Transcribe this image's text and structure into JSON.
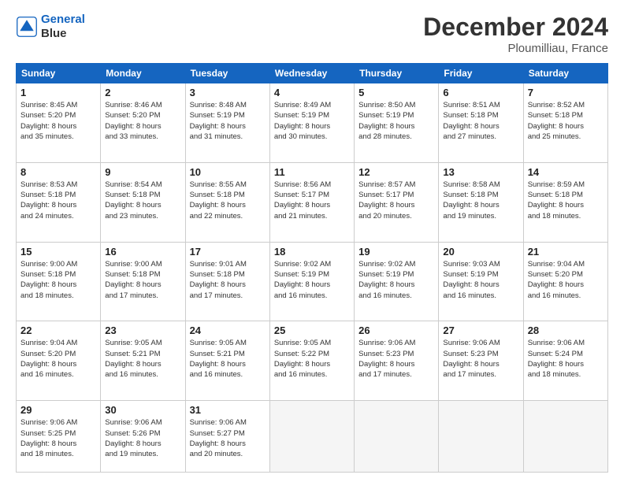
{
  "header": {
    "logo_line1": "General",
    "logo_line2": "Blue",
    "month": "December 2024",
    "location": "Ploumilliau, France"
  },
  "weekdays": [
    "Sunday",
    "Monday",
    "Tuesday",
    "Wednesday",
    "Thursday",
    "Friday",
    "Saturday"
  ],
  "weeks": [
    [
      {
        "day": "1",
        "info": "Sunrise: 8:45 AM\nSunset: 5:20 PM\nDaylight: 8 hours\nand 35 minutes."
      },
      {
        "day": "2",
        "info": "Sunrise: 8:46 AM\nSunset: 5:20 PM\nDaylight: 8 hours\nand 33 minutes."
      },
      {
        "day": "3",
        "info": "Sunrise: 8:48 AM\nSunset: 5:19 PM\nDaylight: 8 hours\nand 31 minutes."
      },
      {
        "day": "4",
        "info": "Sunrise: 8:49 AM\nSunset: 5:19 PM\nDaylight: 8 hours\nand 30 minutes."
      },
      {
        "day": "5",
        "info": "Sunrise: 8:50 AM\nSunset: 5:19 PM\nDaylight: 8 hours\nand 28 minutes."
      },
      {
        "day": "6",
        "info": "Sunrise: 8:51 AM\nSunset: 5:18 PM\nDaylight: 8 hours\nand 27 minutes."
      },
      {
        "day": "7",
        "info": "Sunrise: 8:52 AM\nSunset: 5:18 PM\nDaylight: 8 hours\nand 25 minutes."
      }
    ],
    [
      {
        "day": "8",
        "info": "Sunrise: 8:53 AM\nSunset: 5:18 PM\nDaylight: 8 hours\nand 24 minutes."
      },
      {
        "day": "9",
        "info": "Sunrise: 8:54 AM\nSunset: 5:18 PM\nDaylight: 8 hours\nand 23 minutes."
      },
      {
        "day": "10",
        "info": "Sunrise: 8:55 AM\nSunset: 5:18 PM\nDaylight: 8 hours\nand 22 minutes."
      },
      {
        "day": "11",
        "info": "Sunrise: 8:56 AM\nSunset: 5:17 PM\nDaylight: 8 hours\nand 21 minutes."
      },
      {
        "day": "12",
        "info": "Sunrise: 8:57 AM\nSunset: 5:17 PM\nDaylight: 8 hours\nand 20 minutes."
      },
      {
        "day": "13",
        "info": "Sunrise: 8:58 AM\nSunset: 5:18 PM\nDaylight: 8 hours\nand 19 minutes."
      },
      {
        "day": "14",
        "info": "Sunrise: 8:59 AM\nSunset: 5:18 PM\nDaylight: 8 hours\nand 18 minutes."
      }
    ],
    [
      {
        "day": "15",
        "info": "Sunrise: 9:00 AM\nSunset: 5:18 PM\nDaylight: 8 hours\nand 18 minutes."
      },
      {
        "day": "16",
        "info": "Sunrise: 9:00 AM\nSunset: 5:18 PM\nDaylight: 8 hours\nand 17 minutes."
      },
      {
        "day": "17",
        "info": "Sunrise: 9:01 AM\nSunset: 5:18 PM\nDaylight: 8 hours\nand 17 minutes."
      },
      {
        "day": "18",
        "info": "Sunrise: 9:02 AM\nSunset: 5:19 PM\nDaylight: 8 hours\nand 16 minutes."
      },
      {
        "day": "19",
        "info": "Sunrise: 9:02 AM\nSunset: 5:19 PM\nDaylight: 8 hours\nand 16 minutes."
      },
      {
        "day": "20",
        "info": "Sunrise: 9:03 AM\nSunset: 5:19 PM\nDaylight: 8 hours\nand 16 minutes."
      },
      {
        "day": "21",
        "info": "Sunrise: 9:04 AM\nSunset: 5:20 PM\nDaylight: 8 hours\nand 16 minutes."
      }
    ],
    [
      {
        "day": "22",
        "info": "Sunrise: 9:04 AM\nSunset: 5:20 PM\nDaylight: 8 hours\nand 16 minutes."
      },
      {
        "day": "23",
        "info": "Sunrise: 9:05 AM\nSunset: 5:21 PM\nDaylight: 8 hours\nand 16 minutes."
      },
      {
        "day": "24",
        "info": "Sunrise: 9:05 AM\nSunset: 5:21 PM\nDaylight: 8 hours\nand 16 minutes."
      },
      {
        "day": "25",
        "info": "Sunrise: 9:05 AM\nSunset: 5:22 PM\nDaylight: 8 hours\nand 16 minutes."
      },
      {
        "day": "26",
        "info": "Sunrise: 9:06 AM\nSunset: 5:23 PM\nDaylight: 8 hours\nand 17 minutes."
      },
      {
        "day": "27",
        "info": "Sunrise: 9:06 AM\nSunset: 5:23 PM\nDaylight: 8 hours\nand 17 minutes."
      },
      {
        "day": "28",
        "info": "Sunrise: 9:06 AM\nSunset: 5:24 PM\nDaylight: 8 hours\nand 18 minutes."
      }
    ],
    [
      {
        "day": "29",
        "info": "Sunrise: 9:06 AM\nSunset: 5:25 PM\nDaylight: 8 hours\nand 18 minutes."
      },
      {
        "day": "30",
        "info": "Sunrise: 9:06 AM\nSunset: 5:26 PM\nDaylight: 8 hours\nand 19 minutes."
      },
      {
        "day": "31",
        "info": "Sunrise: 9:06 AM\nSunset: 5:27 PM\nDaylight: 8 hours\nand 20 minutes."
      },
      null,
      null,
      null,
      null
    ]
  ]
}
